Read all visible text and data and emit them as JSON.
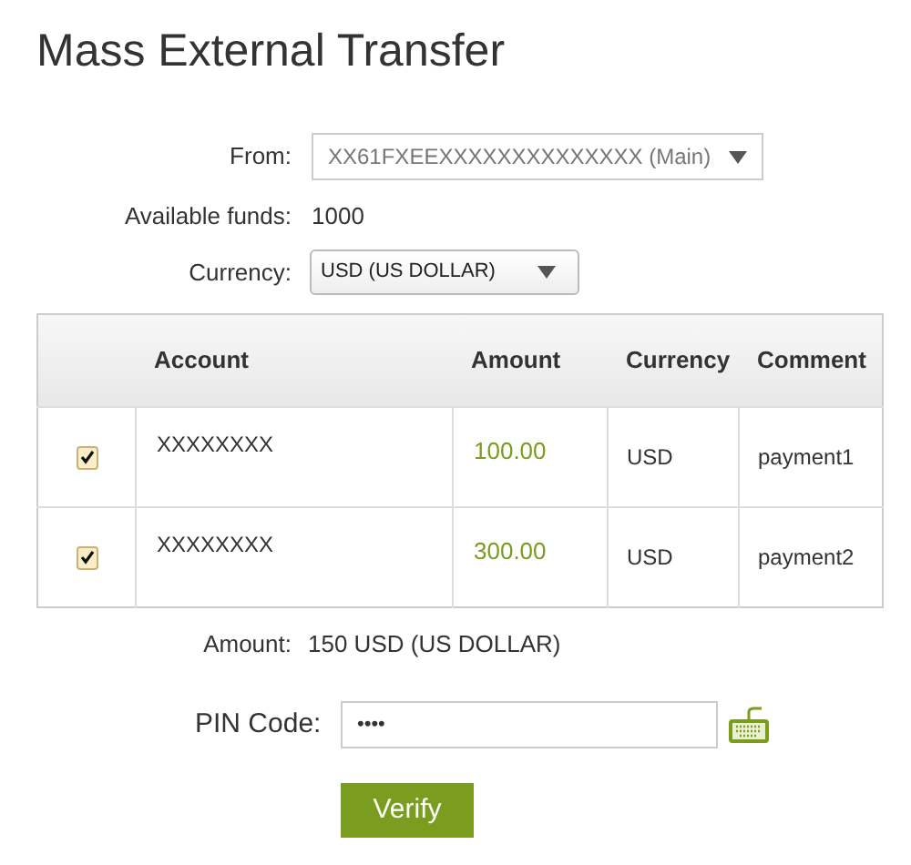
{
  "title": "Mass External Transfer",
  "from": {
    "label": "From:",
    "value": "XX61FXEEXXXXXXXXXXXXXX (Main)"
  },
  "available_funds": {
    "label": "Available funds:",
    "value": "1000"
  },
  "currency": {
    "label": "Currency:",
    "value": "USD (US DOLLAR)"
  },
  "table": {
    "columns": [
      "Account",
      "Amount",
      "Currency",
      "Comment"
    ],
    "rows": [
      {
        "checked": true,
        "account": "XXXXXXXX",
        "amount": "100.00",
        "currency": "USD",
        "comment": "payment1"
      },
      {
        "checked": true,
        "account": "XXXXXXXX",
        "amount": "300.00",
        "currency": "USD",
        "comment": "payment2"
      }
    ]
  },
  "amount": {
    "label": "Amount:",
    "value": "150 USD (US DOLLAR)"
  },
  "pin": {
    "label": "PIN Code:",
    "value": "••••"
  },
  "verify_button": "Verify"
}
